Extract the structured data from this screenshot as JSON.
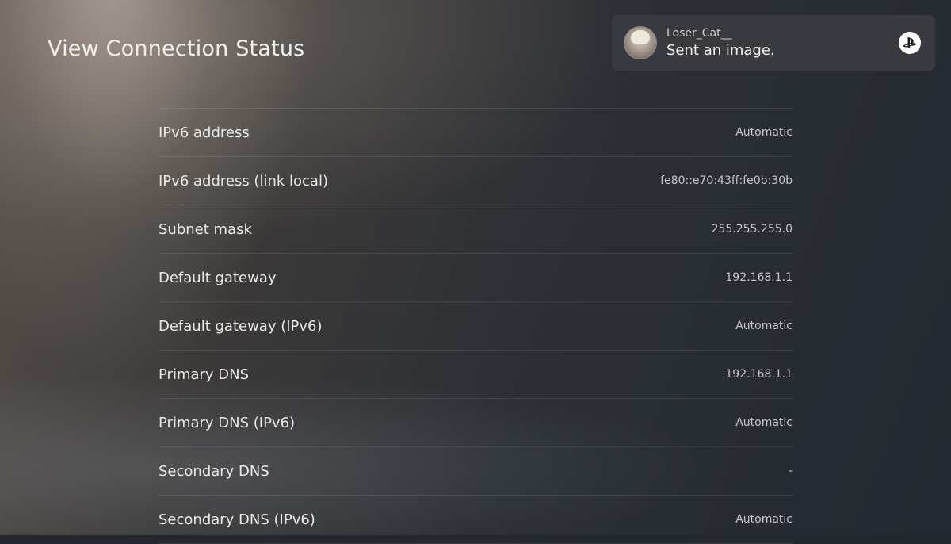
{
  "header": {
    "title": "View Connection Status"
  },
  "rows": [
    {
      "label": "IPv6 address",
      "value": "Automatic"
    },
    {
      "label": "IPv6 address (link local)",
      "value": "fe80::e70:43ff:fe0b:30b"
    },
    {
      "label": "Subnet mask",
      "value": "255.255.255.0"
    },
    {
      "label": "Default gateway",
      "value": "192.168.1.1"
    },
    {
      "label": "Default gateway (IPv6)",
      "value": "Automatic"
    },
    {
      "label": "Primary DNS",
      "value": "192.168.1.1"
    },
    {
      "label": "Primary DNS (IPv6)",
      "value": "Automatic"
    },
    {
      "label": "Secondary DNS",
      "value": "-"
    },
    {
      "label": "Secondary DNS (IPv6)",
      "value": "Automatic"
    }
  ],
  "notification": {
    "username": "Loser_Cat__",
    "message": "Sent an image.",
    "avatar_icon": "user-avatar-icon",
    "badge_icon": "playstation-logo-icon"
  },
  "colors": {
    "background": "#2b2f35",
    "toast_background": "#3a3c40",
    "text_primary": "#ebe9e7",
    "text_secondary": "#c9c7c5"
  }
}
